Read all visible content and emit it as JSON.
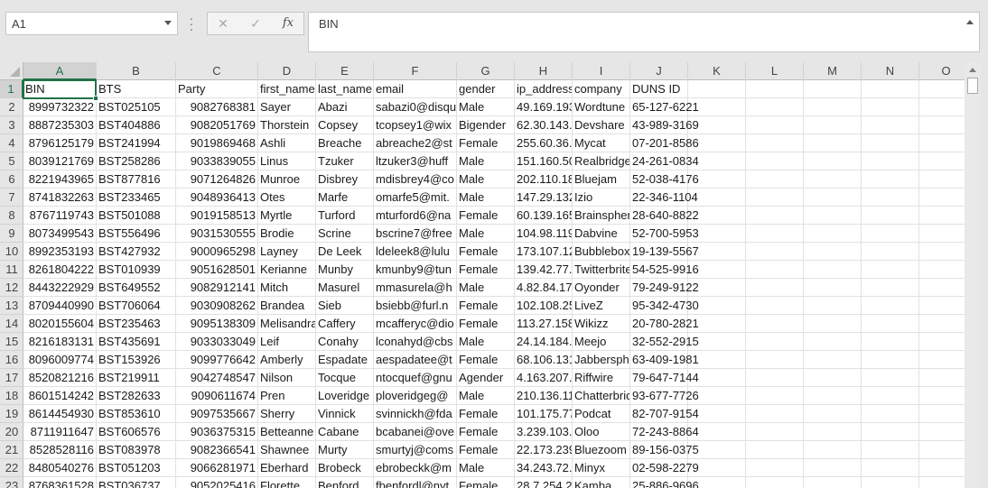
{
  "formula_bar": {
    "name_box": "A1",
    "cancel_icon": "✕",
    "enter_icon": "✓",
    "function_label": "fx",
    "formula": "BIN"
  },
  "columns": [
    "A",
    "B",
    "C",
    "D",
    "E",
    "F",
    "G",
    "H",
    "I",
    "J",
    "K",
    "L",
    "M",
    "N",
    "O"
  ],
  "rows": [
    [
      "BIN",
      "BTS",
      "Party",
      "first_name",
      "last_name",
      "email",
      "gender",
      "ip_address",
      "company",
      "DUNS ID"
    ],
    [
      "8999732322",
      "BST025105",
      "9082768381",
      "Sayer",
      "Abazi",
      "sabazi0@disqus",
      "Male",
      "49.169.193",
      "Wordtune",
      "65-127-6221"
    ],
    [
      "8887235303",
      "BST404886",
      "9082051769",
      "Thorstein",
      "Copsey",
      "tcopsey1@wix",
      "Bigender",
      "62.30.143.",
      "Devshare",
      "43-989-3169"
    ],
    [
      "8796125179",
      "BST241994",
      "9019869468",
      "Ashli",
      "Breache",
      "abreache2@st",
      "Female",
      "255.60.36.",
      "Mycat",
      "07-201-8586"
    ],
    [
      "8039121769",
      "BST258286",
      "9033839055",
      "Linus",
      "Tzuker",
      "ltzuker3@huff",
      "Male",
      "151.160.50",
      "Realbridge",
      "24-261-0834"
    ],
    [
      "8221943965",
      "BST877816",
      "9071264826",
      "Munroe",
      "Disbrey",
      "mdisbrey4@co",
      "Male",
      "202.110.18",
      "Bluejam",
      "52-038-4176"
    ],
    [
      "8741832263",
      "BST233465",
      "9048936413",
      "Otes",
      "Marfe",
      "omarfe5@mit.",
      "Male",
      "147.29.132",
      "Izio",
      "22-346-1104"
    ],
    [
      "8767119743",
      "BST501088",
      "9019158513",
      "Myrtle",
      "Turford",
      "mturford6@na",
      "Female",
      "60.139.165",
      "Brainsphere",
      "28-640-8822"
    ],
    [
      "8073499543",
      "BST556496",
      "9031530555",
      "Brodie",
      "Scrine",
      "bscrine7@free",
      "Male",
      "104.98.119",
      "Dabvine",
      "52-700-5953"
    ],
    [
      "8992353193",
      "BST427932",
      "9000965298",
      "Layney",
      "De Leek",
      "ldeleek8@lulu",
      "Female",
      "173.107.12",
      "Bubblebox",
      "19-139-5567"
    ],
    [
      "8261804222",
      "BST010939",
      "9051628501",
      "Kerianne",
      "Munby",
      "kmunby9@tun",
      "Female",
      "139.42.77.",
      "Twitterbrite",
      "54-525-9916"
    ],
    [
      "8443222929",
      "BST649552",
      "9082912141",
      "Mitch",
      "Masurel",
      "mmasurela@h",
      "Male",
      "4.82.84.17",
      "Oyonder",
      "79-249-9122"
    ],
    [
      "8709440990",
      "BST706064",
      "9030908262",
      "Brandea",
      "Sieb",
      "bsiebb@furl.n",
      "Female",
      "102.108.25",
      "LiveZ",
      "95-342-4730"
    ],
    [
      "8020155604",
      "BST235463",
      "9095138309",
      "Melisandra",
      "Caffery",
      "mcafferyc@dio",
      "Female",
      "113.27.158",
      "Wikizz",
      "20-780-2821"
    ],
    [
      "8216183131",
      "BST435691",
      "9033033049",
      "Leif",
      "Conahy",
      "lconahyd@cbs",
      "Male",
      "24.14.184.",
      "Meejo",
      "32-552-2915"
    ],
    [
      "8096009774",
      "BST153926",
      "9099776642",
      "Amberly",
      "Espadate",
      "aespadatee@t",
      "Female",
      "68.106.131",
      "Jabbersphere",
      "63-409-1981"
    ],
    [
      "8520821216",
      "BST219911",
      "9042748547",
      "Nilson",
      "Tocque",
      "ntocquef@gnu",
      "Agender",
      "4.163.207.",
      "Riffwire",
      "79-647-7144"
    ],
    [
      "8601514242",
      "BST282633",
      "9090611674",
      "Pren",
      "Loveridge",
      "ploveridgeg@",
      "Male",
      "210.136.11",
      "Chatterbridge",
      "93-677-7726"
    ],
    [
      "8614454930",
      "BST853610",
      "9097535667",
      "Sherry",
      "Vinnick",
      "svinnickh@fda",
      "Female",
      "101.175.77",
      "Podcat",
      "82-707-9154"
    ],
    [
      "8711911647",
      "BST606576",
      "9036375315",
      "Betteanne",
      "Cabane",
      "bcabanei@ove",
      "Female",
      "3.239.103.",
      "Oloo",
      "72-243-8864"
    ],
    [
      "8528528116",
      "BST083978",
      "9082366541",
      "Shawnee",
      "Murty",
      "smurtyj@coms",
      "Female",
      "22.173.239",
      "Bluezoom",
      "89-156-0375"
    ],
    [
      "8480540276",
      "BST051203",
      "9066281971",
      "Eberhard",
      "Brobeck",
      "ebrobeckk@m",
      "Male",
      "34.243.72.",
      "Minyx",
      "02-598-2279"
    ],
    [
      "8768361528",
      "BST036737",
      "9052025416",
      "Florette",
      "Benford",
      "fbenfordl@nyt",
      "Female",
      "28.7.254.2",
      "Kamba",
      "25-886-9696"
    ]
  ]
}
